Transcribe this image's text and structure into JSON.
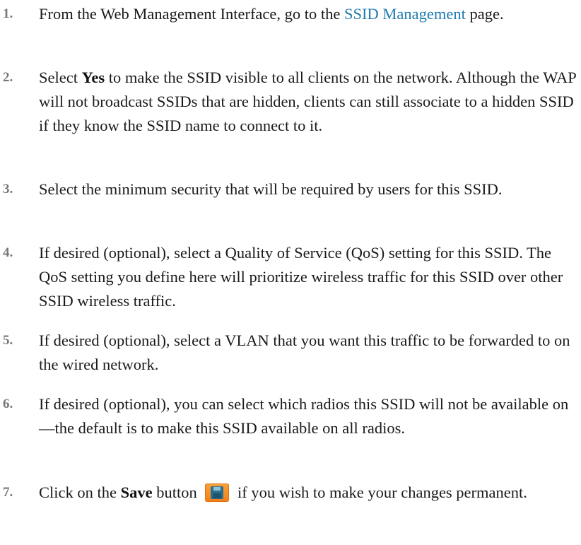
{
  "steps": [
    {
      "number": "1.",
      "prefix": "From the Web Management Interface, go to the ",
      "link": "SSID Management",
      "suffix": " page."
    },
    {
      "number": "2.",
      "prefix": "Select ",
      "bold": "Yes",
      "suffix": " to make the SSID visible to all clients on the network. Although the WAP will not broadcast SSIDs that are hidden, clients can still associate to a hidden SSID if they know the SSID name to connect to it."
    },
    {
      "number": "3.",
      "text": "Select the minimum security that will be required by users for this SSID."
    },
    {
      "number": "4.",
      "text": "If desired (optional), select a Quality of Service (QoS) setting for this SSID. The QoS setting you define here will prioritize wireless traffic for this SSID over other SSID wireless traffic."
    },
    {
      "number": "5.",
      "text": "If desired (optional), select a VLAN that you want this traffic to be forwarded to on the wired network."
    },
    {
      "number": "6.",
      "text": "If desired (optional), you can select which radios this SSID will not be available on—the default is to make this SSID available on all radios."
    },
    {
      "number": "7.",
      "prefix": "Click on the ",
      "bold": "Save",
      "middle": " button ",
      "suffix": " if you wish to make your changes permanent.",
      "icon": "save-disk-icon"
    }
  ]
}
